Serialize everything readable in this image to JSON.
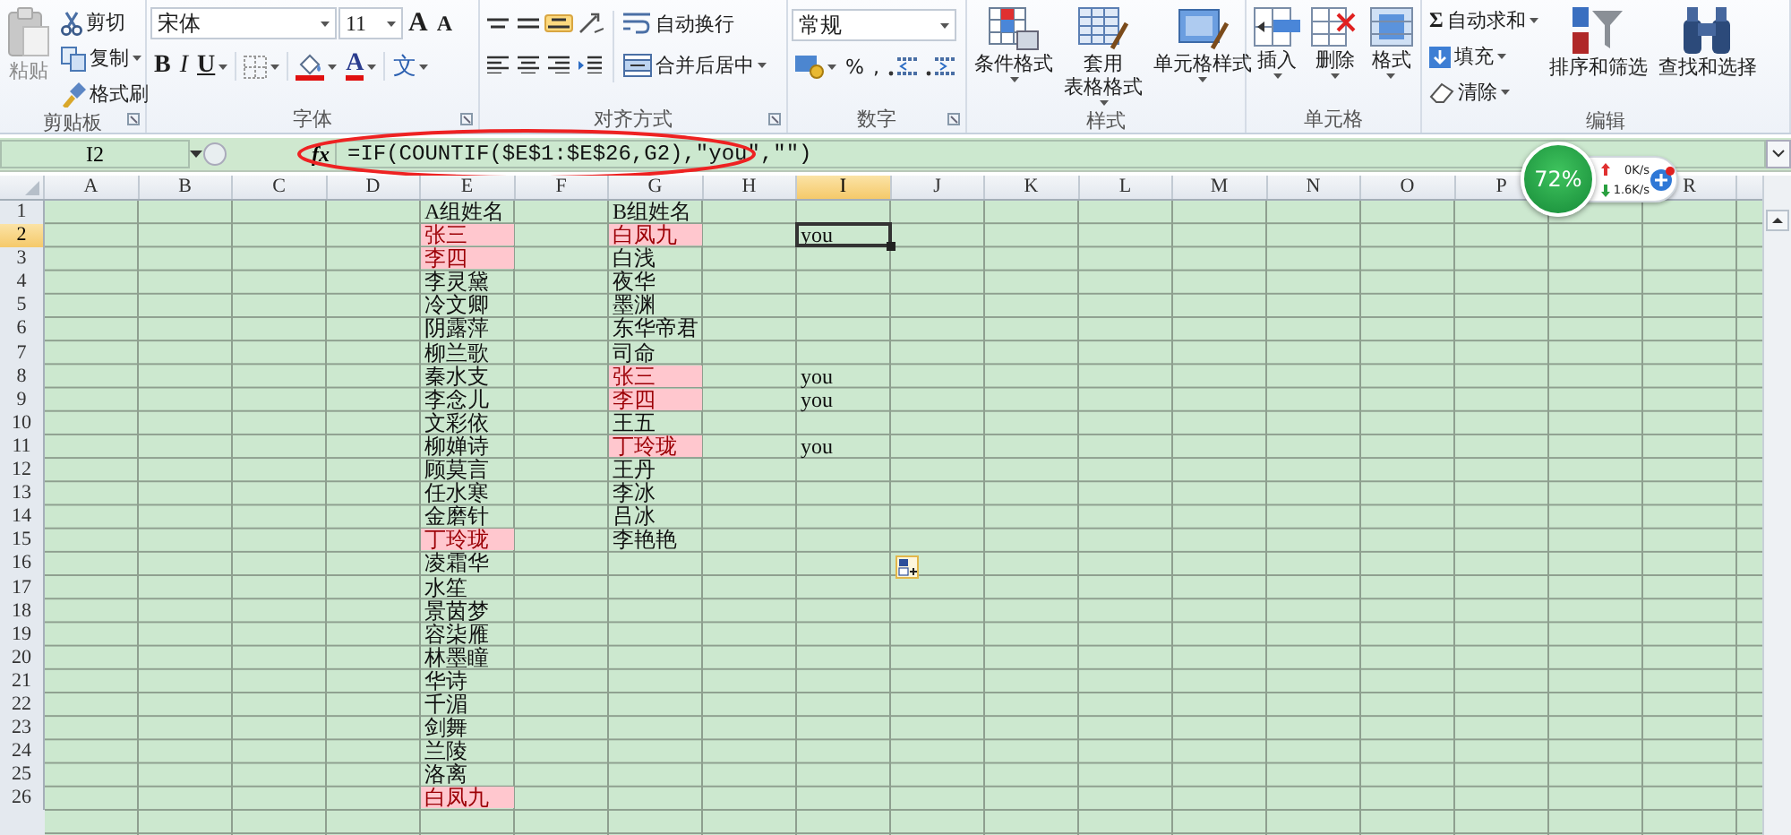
{
  "ribbon": {
    "groups": [
      {
        "kind": "clipboard",
        "label": "剪贴板",
        "items": [
          {
            "kind": "paste",
            "label": "粘贴",
            "disabled": true
          },
          {
            "kind": "cut",
            "label": "剪切",
            "disabled": false
          },
          {
            "kind": "copy",
            "label": "复制",
            "disabled": false
          },
          {
            "kind": "painter",
            "label": "格式刷",
            "disabled": false
          }
        ]
      },
      {
        "kind": "font",
        "label": "字体",
        "items": [
          {
            "kind": "font",
            "label": "宋体"
          },
          {
            "kind": "size",
            "label": "11"
          },
          {
            "kind": "grow",
            "label": "A"
          },
          {
            "kind": "shrink",
            "label": "A"
          },
          {
            "kind": "bold",
            "label": "B"
          },
          {
            "kind": "italic",
            "label": "I"
          },
          {
            "kind": "underline",
            "label": "U"
          },
          {
            "kind": "borders"
          },
          {
            "kind": "fill"
          },
          {
            "kind": "fontcolor",
            "label": "A"
          },
          {
            "kind": "phonetic",
            "label": "文"
          }
        ]
      },
      {
        "kind": "alignment",
        "label": "对齐方式",
        "items": [
          {
            "kind": "valign-top",
            "on": false
          },
          {
            "kind": "valign-middle",
            "on": false
          },
          {
            "kind": "valign-bottom",
            "on": true
          },
          {
            "kind": "orientation",
            "on": false
          },
          {
            "kind": "align-left",
            "on": false
          },
          {
            "kind": "align-center",
            "on": false
          },
          {
            "kind": "align-right",
            "on": false
          },
          {
            "kind": "indent",
            "on": false
          },
          {
            "kind": "wrap",
            "label": "自动换行",
            "on": false
          },
          {
            "kind": "merge",
            "label": "合并后居中",
            "on": false
          }
        ]
      },
      {
        "kind": "number",
        "label": "数字",
        "items": [
          {
            "kind": "format",
            "label": "常规"
          },
          {
            "kind": "currency"
          },
          {
            "kind": "percent",
            "label": "%"
          },
          {
            "kind": "comma",
            "label": ","
          },
          {
            "kind": "inc-decimal"
          },
          {
            "kind": "dec-decimal"
          }
        ]
      },
      {
        "kind": "styles",
        "label": "样式",
        "items": [
          {
            "kind": "conditional",
            "lines": [
              "条件格式"
            ]
          },
          {
            "kind": "table",
            "lines": [
              "套用",
              "表格格式"
            ]
          },
          {
            "kind": "cellstyle",
            "lines": [
              "单元格样式"
            ]
          }
        ]
      },
      {
        "kind": "cells",
        "label": "单元格",
        "items": [
          {
            "kind": "insert",
            "lines": [
              "插入"
            ]
          },
          {
            "kind": "delete",
            "lines": [
              "删除"
            ]
          },
          {
            "kind": "cellformat",
            "lines": [
              "格式"
            ]
          }
        ]
      },
      {
        "kind": "editing",
        "label": "编辑",
        "items": [
          {
            "kind": "sum",
            "symbol": "Σ",
            "label": "自动求和"
          },
          {
            "kind": "filldown",
            "label": "填充"
          },
          {
            "kind": "clear",
            "label": "清除"
          },
          {
            "kind": "sort",
            "lines": [
              "排序和筛选"
            ]
          },
          {
            "kind": "find",
            "lines": [
              "查找和选择"
            ]
          }
        ]
      }
    ]
  },
  "formula_bar": {
    "name_box": "I2",
    "function_label": "fx",
    "formula": "=IF(COUNTIF($E$1:$E$26,G2),\"you\",\"\")"
  },
  "sheet": {
    "columns": [
      "A",
      "B",
      "C",
      "D",
      "E",
      "F",
      "G",
      "H",
      "I",
      "J",
      "K",
      "L",
      "M",
      "N",
      "O",
      "P",
      null,
      "R"
    ],
    "rows": [
      {
        "number": "1",
        "cells": {
          "E": {
            "text": "A组姓名",
            "highlighted": false,
            "selected": false
          },
          "G": {
            "text": "B组姓名",
            "highlighted": false,
            "selected": false
          }
        }
      },
      {
        "number": "2",
        "cells": {
          "E": {
            "text": "张三",
            "highlighted": true,
            "selected": false
          },
          "G": {
            "text": "白凤九",
            "highlighted": true,
            "selected": false
          },
          "I": {
            "text": "you",
            "highlighted": false,
            "selected": true
          }
        }
      },
      {
        "number": "3",
        "cells": {
          "E": {
            "text": "李四",
            "highlighted": true,
            "selected": false
          },
          "G": {
            "text": "白浅",
            "highlighted": false,
            "selected": false
          }
        }
      },
      {
        "number": "4",
        "cells": {
          "E": {
            "text": "李灵黛",
            "highlighted": false,
            "selected": false
          },
          "G": {
            "text": "夜华",
            "highlighted": false,
            "selected": false
          }
        }
      },
      {
        "number": "5",
        "cells": {
          "E": {
            "text": "冷文卿",
            "highlighted": false,
            "selected": false
          },
          "G": {
            "text": "墨渊",
            "highlighted": false,
            "selected": false
          }
        }
      },
      {
        "number": "6",
        "cells": {
          "E": {
            "text": "阴露萍",
            "highlighted": false,
            "selected": false
          },
          "G": {
            "text": "东华帝君",
            "highlighted": false,
            "selected": false
          }
        }
      },
      {
        "number": "7",
        "cells": {
          "E": {
            "text": "柳兰歌",
            "highlighted": false,
            "selected": false
          },
          "G": {
            "text": "司命",
            "highlighted": false,
            "selected": false
          }
        }
      },
      {
        "number": "8",
        "cells": {
          "E": {
            "text": "秦水支",
            "highlighted": false,
            "selected": false
          },
          "G": {
            "text": "张三",
            "highlighted": true,
            "selected": false
          },
          "I": {
            "text": "you",
            "highlighted": false,
            "selected": false
          }
        }
      },
      {
        "number": "9",
        "cells": {
          "E": {
            "text": "李念儿",
            "highlighted": false,
            "selected": false
          },
          "G": {
            "text": "李四",
            "highlighted": true,
            "selected": false
          },
          "I": {
            "text": "you",
            "highlighted": false,
            "selected": false
          }
        }
      },
      {
        "number": "10",
        "cells": {
          "E": {
            "text": "文彩依",
            "highlighted": false,
            "selected": false
          },
          "G": {
            "text": "王五",
            "highlighted": false,
            "selected": false
          }
        }
      },
      {
        "number": "11",
        "cells": {
          "E": {
            "text": "柳婵诗",
            "highlighted": false,
            "selected": false
          },
          "G": {
            "text": "丁玲珑",
            "highlighted": true,
            "selected": false
          },
          "I": {
            "text": "you",
            "highlighted": false,
            "selected": false
          }
        }
      },
      {
        "number": "12",
        "cells": {
          "E": {
            "text": "顾莫言",
            "highlighted": false,
            "selected": false
          },
          "G": {
            "text": "王丹",
            "highlighted": false,
            "selected": false
          }
        }
      },
      {
        "number": "13",
        "cells": {
          "E": {
            "text": "任水寒",
            "highlighted": false,
            "selected": false
          },
          "G": {
            "text": "李冰",
            "highlighted": false,
            "selected": false
          }
        }
      },
      {
        "number": "14",
        "cells": {
          "E": {
            "text": "金磨针",
            "highlighted": false,
            "selected": false
          },
          "G": {
            "text": "吕冰",
            "highlighted": false,
            "selected": false
          }
        }
      },
      {
        "number": "15",
        "cells": {
          "E": {
            "text": "丁玲珑",
            "highlighted": true,
            "selected": false
          },
          "G": {
            "text": "李艳艳",
            "highlighted": false,
            "selected": false
          }
        }
      },
      {
        "number": "16",
        "cells": {
          "E": {
            "text": "凌霜华",
            "highlighted": false,
            "selected": false
          }
        }
      },
      {
        "number": "17",
        "cells": {
          "E": {
            "text": "水笙",
            "highlighted": false,
            "selected": false
          }
        }
      },
      {
        "number": "18",
        "cells": {
          "E": {
            "text": "景茵梦",
            "highlighted": false,
            "selected": false
          }
        }
      },
      {
        "number": "19",
        "cells": {
          "E": {
            "text": "容柒雁",
            "highlighted": false,
            "selected": false
          }
        }
      },
      {
        "number": "20",
        "cells": {
          "E": {
            "text": "林墨瞳",
            "highlighted": false,
            "selected": false
          }
        }
      },
      {
        "number": "21",
        "cells": {
          "E": {
            "text": "华诗",
            "highlighted": false,
            "selected": false
          }
        }
      },
      {
        "number": "22",
        "cells": {
          "E": {
            "text": "千湄",
            "highlighted": false,
            "selected": false
          }
        }
      },
      {
        "number": "23",
        "cells": {
          "E": {
            "text": "剑舞",
            "highlighted": false,
            "selected": false
          }
        }
      },
      {
        "number": "24",
        "cells": {
          "E": {
            "text": "兰陵",
            "highlighted": false,
            "selected": false
          }
        }
      },
      {
        "number": "25",
        "cells": {
          "E": {
            "text": "洛离",
            "highlighted": false,
            "selected": false
          }
        }
      },
      {
        "number": "26",
        "cells": {
          "E": {
            "text": "白凤九",
            "highlighted": true,
            "selected": false
          }
        }
      }
    ]
  },
  "speed_widget": {
    "percent": "72%",
    "upload": "0K/s",
    "download": "1.6K/s"
  }
}
